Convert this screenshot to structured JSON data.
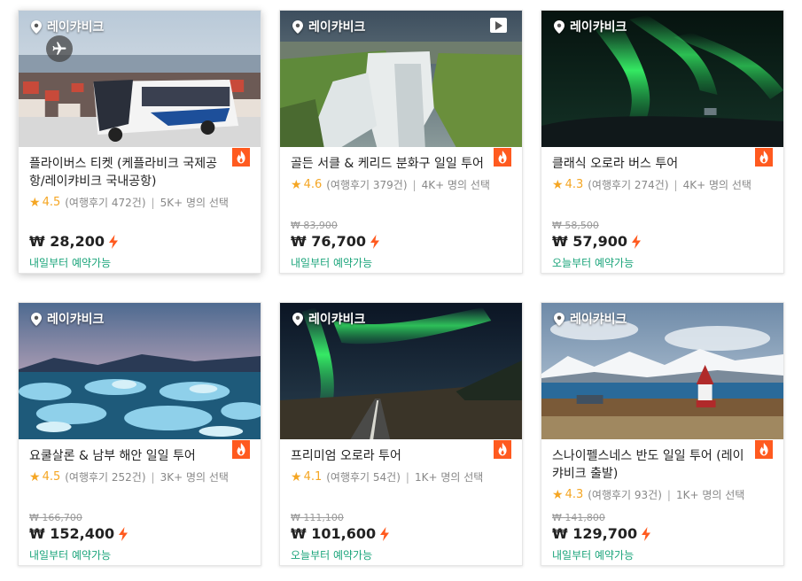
{
  "colors": {
    "accent": "#ff5a1f",
    "star": "#f5a623",
    "availability": "#1aa47a"
  },
  "cards": [
    {
      "location": "레이캬비크",
      "title": "플라이버스 티켓 (케플라비크 국제공항/레이캬비크 국내공항)",
      "score": "4.5",
      "reviews": "(여행후기 472건)",
      "chosen": "5K+ 명의 선택",
      "old_price": "",
      "price": "₩ 28,200",
      "availability": "내일부터 예약가능",
      "badge_icon": "airplane-icon"
    },
    {
      "location": "레이캬비크",
      "title": "골든 서클 & 케리드 분화구 일일 투어",
      "score": "4.6",
      "reviews": "(여행후기 379건)",
      "chosen": "4K+ 명의 선택",
      "old_price": "₩ 83,900",
      "price": "₩ 76,700",
      "availability": "내일부터 예약가능",
      "badge_icon": "video-play-icon"
    },
    {
      "location": "레이캬비크",
      "title": "클래식 오로라 버스 투어",
      "score": "4.3",
      "reviews": "(여행후기 274건)",
      "chosen": "4K+ 명의 선택",
      "old_price": "₩ 58,500",
      "price": "₩ 57,900",
      "availability": "오늘부터 예약가능"
    },
    {
      "location": "레이캬비크",
      "title": "요쿨살론 & 남부 해안 일일 투어",
      "score": "4.5",
      "reviews": "(여행후기 252건)",
      "chosen": "3K+ 명의 선택",
      "old_price": "₩ 166,700",
      "price": "₩ 152,400",
      "availability": "내일부터 예약가능"
    },
    {
      "location": "레이캬비크",
      "title": "프리미엄 오로라 투어",
      "score": "4.1",
      "reviews": "(여행후기 54건)",
      "chosen": "1K+ 명의 선택",
      "old_price": "₩ 111,100",
      "price": "₩ 101,600",
      "availability": "오늘부터 예약가능"
    },
    {
      "location": "레이캬비크",
      "title": "스나이펠스네스 반도 일일 투어 (레이캬비크 출발)",
      "score": "4.3",
      "reviews": "(여행후기 93건)",
      "chosen": "1K+ 명의 선택",
      "old_price": "₩ 141,800",
      "price": "₩ 129,700",
      "availability": "내일부터 예약가능"
    }
  ]
}
